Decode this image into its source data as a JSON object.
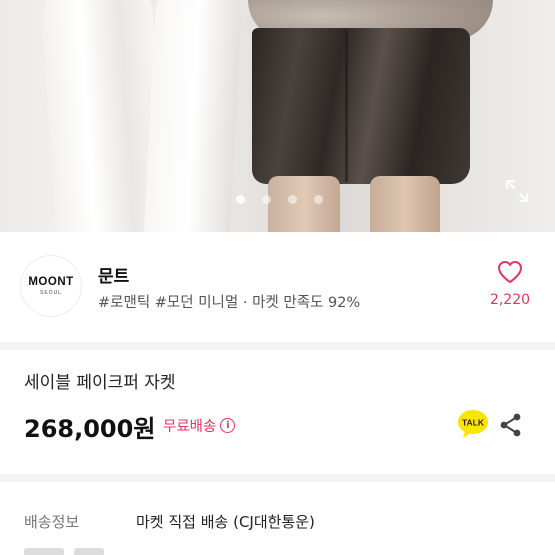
{
  "gallery": {
    "dot_count": 4,
    "active_index": 0
  },
  "seller": {
    "logo_text": "MOONT",
    "logo_sub": "SEOUL",
    "name": "문트",
    "tags": "#로맨틱 #모던 미니멀 · 마켓 만족도 92%",
    "likes": "2,220"
  },
  "product": {
    "title": "세이블 페이크퍼 자켓",
    "price": "268,000원",
    "shipping_badge": "무료배송",
    "info_icon": "i"
  },
  "talk": {
    "label": "TALK"
  },
  "shipping_info": {
    "label": "배송정보",
    "value": "마켓 직접 배송 (CJ대한통운)"
  },
  "colors": {
    "accent": "#e8345a",
    "talk_bubble": "#f7e600"
  },
  "icons": {
    "expand": "expand-icon",
    "heart": "heart-icon",
    "talk": "kakao-talk-icon",
    "share": "share-icon",
    "info": "info-icon"
  }
}
